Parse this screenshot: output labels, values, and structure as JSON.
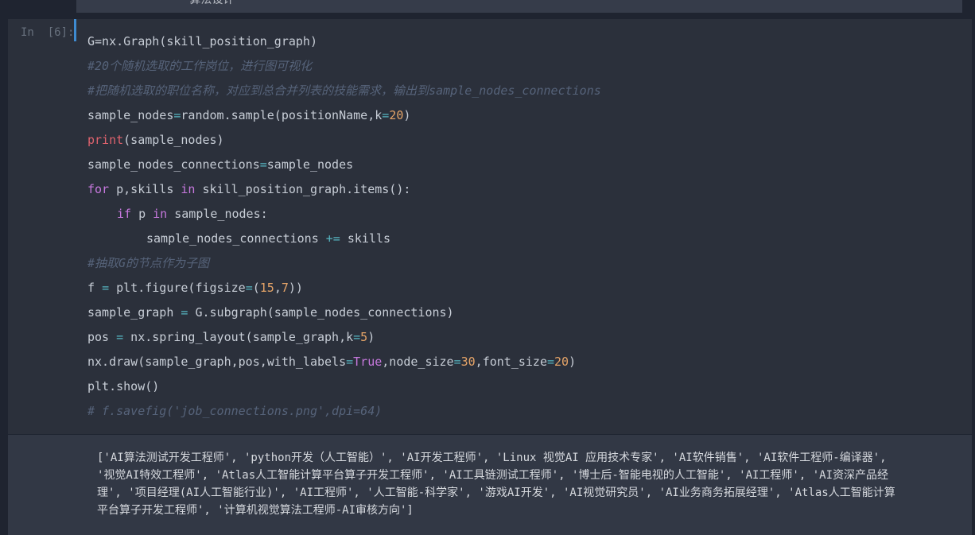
{
  "prev_cell": {
    "fragment": "'算法设计'"
  },
  "cell": {
    "prompt": "In  [6]:",
    "code_lines": [
      [
        {
          "t": "G=nx.Graph(skill_position_graph)"
        }
      ],
      [
        {
          "t": "#20个随机选取的工作岗位，进行图可视化",
          "c": "cm"
        }
      ],
      [
        {
          "t": "#把随机选取的职位名称，对应到总合并列表的技能需求，输出到sample_nodes_connections",
          "c": "cm"
        }
      ],
      [
        {
          "t": "sample_nodes"
        },
        {
          "t": "=",
          "c": "op"
        },
        {
          "t": "random.sample(positionName,k"
        },
        {
          "t": "=",
          "c": "op"
        },
        {
          "t": "20",
          "c": "num"
        },
        {
          "t": ")"
        }
      ],
      [
        {
          "t": "print",
          "c": "bi"
        },
        {
          "t": "(sample_nodes)"
        }
      ],
      [
        {
          "t": "sample_nodes_connections"
        },
        {
          "t": "=",
          "c": "op"
        },
        {
          "t": "sample_nodes"
        }
      ],
      [
        {
          "t": "for",
          "c": "kw"
        },
        {
          "t": " p,skills "
        },
        {
          "t": "in",
          "c": "kw"
        },
        {
          "t": " skill_position_graph.items():"
        }
      ],
      [
        {
          "t": "if",
          "c": "kw",
          "i": 1
        },
        {
          "t": " p "
        },
        {
          "t": "in",
          "c": "kw"
        },
        {
          "t": " sample_nodes:"
        }
      ],
      [
        {
          "t": "sample_nodes_connections ",
          "i": 2
        },
        {
          "t": "+=",
          "c": "op"
        },
        {
          "t": " skills"
        }
      ],
      [
        {
          "t": "#抽取G的节点作为子图",
          "c": "cm"
        }
      ],
      [
        {
          "t": "f "
        },
        {
          "t": "=",
          "c": "op"
        },
        {
          "t": " plt.figure(figsize"
        },
        {
          "t": "=",
          "c": "op"
        },
        {
          "t": "("
        },
        {
          "t": "15",
          "c": "num"
        },
        {
          "t": ","
        },
        {
          "t": "7",
          "c": "num"
        },
        {
          "t": "))"
        }
      ],
      [
        {
          "t": "sample_graph "
        },
        {
          "t": "=",
          "c": "op"
        },
        {
          "t": " G.subgraph(sample_nodes_connections)"
        }
      ],
      [
        {
          "t": "pos "
        },
        {
          "t": "=",
          "c": "op"
        },
        {
          "t": " nx.spring_layout(sample_graph,k"
        },
        {
          "t": "=",
          "c": "op"
        },
        {
          "t": "5",
          "c": "num"
        },
        {
          "t": ")"
        }
      ],
      [
        {
          "t": "nx.draw(sample_graph,pos,with_labels"
        },
        {
          "t": "=",
          "c": "op"
        },
        {
          "t": "True",
          "c": "kw"
        },
        {
          "t": ",node_size"
        },
        {
          "t": "=",
          "c": "op"
        },
        {
          "t": "30",
          "c": "num"
        },
        {
          "t": ",font_size"
        },
        {
          "t": "=",
          "c": "op"
        },
        {
          "t": "20",
          "c": "num"
        },
        {
          "t": ")"
        }
      ],
      [
        {
          "t": "plt.show()"
        }
      ],
      [
        {
          "t": "# f.savefig('job_connections.png',dpi=64)",
          "c": "cm"
        }
      ]
    ]
  },
  "output": {
    "lines": [
      "['AI算法测试开发工程师', 'python开发（人工智能）', 'AI开发工程师', 'Linux 视觉AI 应用技术专家', 'AI软件销售', 'AI软件工程师-编译器',",
      "'视觉AI特效工程师', 'Atlas人工智能计算平台算子开发工程师', 'AI工具链测试工程师', '博士后-智能电视的人工智能', 'AI工程师', 'AI资深产品经",
      "理', '项目经理(AI人工智能行业)', 'AI工程师', '人工智能-科学家', '游戏AI开发', 'AI视觉研究员', 'AI业务商务拓展经理', 'Atlas人工智能计算",
      "平台算子开发工程师', '计算机视觉算法工程师-AI审核方向']"
    ]
  }
}
